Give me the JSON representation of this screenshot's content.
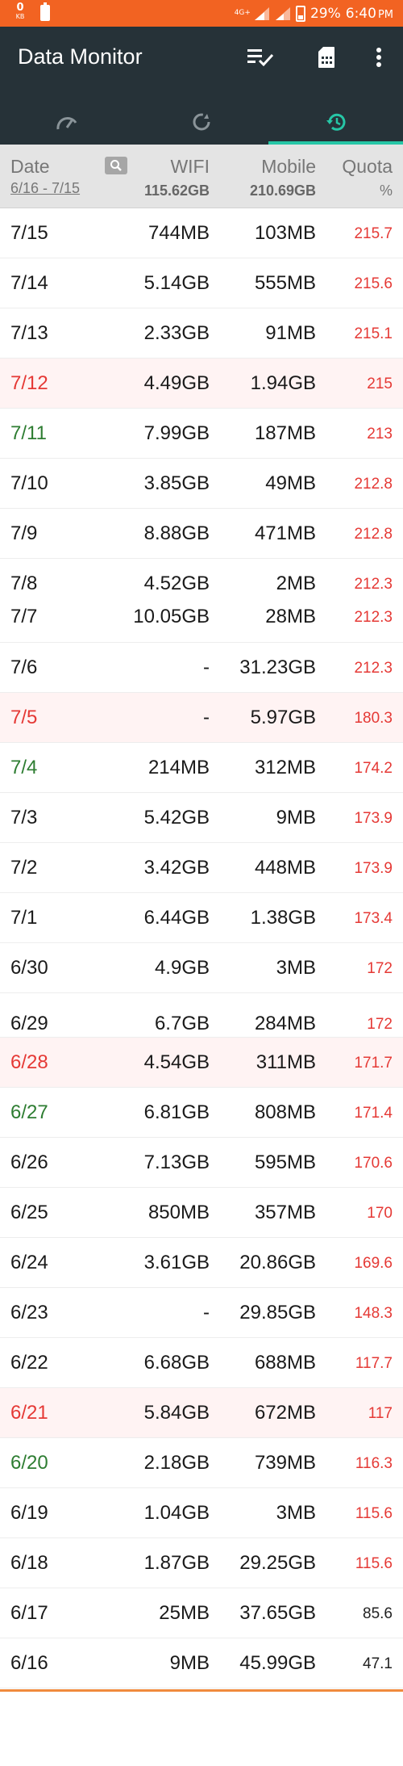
{
  "statusbar": {
    "speed_value": "0",
    "speed_unit": "KB",
    "network_type": "4G+",
    "battery_percent": "29%",
    "time": "6:40",
    "ampm": "PM"
  },
  "appbar": {
    "title": "Data Monitor"
  },
  "tabs": [
    {
      "icon": "gauge-icon",
      "active": false
    },
    {
      "icon": "cycle-icon",
      "active": false
    },
    {
      "icon": "history-icon",
      "active": true
    }
  ],
  "header": {
    "date_label": "Date",
    "date_range": "6/16 - 7/15",
    "wifi_label": "WIFI",
    "wifi_total": "115.62GB",
    "mobile_label": "Mobile",
    "mobile_total": "210.69GB",
    "quota_label": "Quota",
    "quota_unit": "%"
  },
  "colors": {
    "statusbar": "#f26322",
    "appbar": "#263238",
    "tab_indicator": "#26c6a6",
    "quota_red": "#e53935",
    "date_green": "#2e7d32"
  },
  "rows": [
    {
      "date": "7/15",
      "wifi": "744MB",
      "mobile": "103MB",
      "quota": "215.7",
      "date_color": "normal"
    },
    {
      "date": "7/14",
      "wifi": "5.14GB",
      "mobile": "555MB",
      "quota": "215.6",
      "date_color": "normal"
    },
    {
      "date": "7/13",
      "wifi": "2.33GB",
      "mobile": "91MB",
      "quota": "215.1",
      "date_color": "normal"
    },
    {
      "date": "7/12",
      "wifi": "4.49GB",
      "mobile": "1.94GB",
      "quota": "215",
      "date_color": "red"
    },
    {
      "date": "7/11",
      "wifi": "7.99GB",
      "mobile": "187MB",
      "quota": "213",
      "date_color": "green"
    },
    {
      "date": "7/10",
      "wifi": "3.85GB",
      "mobile": "49MB",
      "quota": "212.8",
      "date_color": "normal"
    },
    {
      "date": "7/9",
      "wifi": "8.88GB",
      "mobile": "471MB",
      "quota": "212.8",
      "date_color": "normal"
    },
    {
      "date": "7/8",
      "wifi": "4.52GB",
      "mobile": "2MB",
      "quota": "212.3",
      "date_color": "normal"
    },
    {
      "date": "7/7",
      "wifi": "10.05GB",
      "mobile": "28MB",
      "quota": "212.3",
      "date_color": "normal"
    },
    {
      "date": "7/6",
      "wifi": "-",
      "mobile": "31.23GB",
      "quota": "212.3",
      "date_color": "normal"
    },
    {
      "date": "7/5",
      "wifi": "-",
      "mobile": "5.97GB",
      "quota": "180.3",
      "date_color": "red"
    },
    {
      "date": "7/4",
      "wifi": "214MB",
      "mobile": "312MB",
      "quota": "174.2",
      "date_color": "green"
    },
    {
      "date": "7/3",
      "wifi": "5.42GB",
      "mobile": "9MB",
      "quota": "173.9",
      "date_color": "normal"
    },
    {
      "date": "7/2",
      "wifi": "3.42GB",
      "mobile": "448MB",
      "quota": "173.9",
      "date_color": "normal"
    },
    {
      "date": "7/1",
      "wifi": "6.44GB",
      "mobile": "1.38GB",
      "quota": "173.4",
      "date_color": "normal"
    },
    {
      "date": "6/30",
      "wifi": "4.9GB",
      "mobile": "3MB",
      "quota": "172",
      "date_color": "normal"
    },
    {
      "date": "6/29",
      "wifi": "6.7GB",
      "mobile": "284MB",
      "quota": "172",
      "date_color": "normal"
    },
    {
      "date": "6/28",
      "wifi": "4.54GB",
      "mobile": "311MB",
      "quota": "171.7",
      "date_color": "red"
    },
    {
      "date": "6/27",
      "wifi": "6.81GB",
      "mobile": "808MB",
      "quota": "171.4",
      "date_color": "green"
    },
    {
      "date": "6/26",
      "wifi": "7.13GB",
      "mobile": "595MB",
      "quota": "170.6",
      "date_color": "normal"
    },
    {
      "date": "6/25",
      "wifi": "850MB",
      "mobile": "357MB",
      "quota": "170",
      "date_color": "normal"
    },
    {
      "date": "6/24",
      "wifi": "3.61GB",
      "mobile": "20.86GB",
      "quota": "169.6",
      "date_color": "normal"
    },
    {
      "date": "6/23",
      "wifi": "-",
      "mobile": "29.85GB",
      "quota": "148.3",
      "date_color": "normal"
    },
    {
      "date": "6/22",
      "wifi": "6.68GB",
      "mobile": "688MB",
      "quota": "117.7",
      "date_color": "normal"
    },
    {
      "date": "6/21",
      "wifi": "5.84GB",
      "mobile": "672MB",
      "quota": "117",
      "date_color": "red"
    },
    {
      "date": "6/20",
      "wifi": "2.18GB",
      "mobile": "739MB",
      "quota": "116.3",
      "date_color": "green"
    },
    {
      "date": "6/19",
      "wifi": "1.04GB",
      "mobile": "3MB",
      "quota": "115.6",
      "date_color": "normal"
    },
    {
      "date": "6/18",
      "wifi": "1.87GB",
      "mobile": "29.25GB",
      "quota": "115.6",
      "date_color": "normal"
    },
    {
      "date": "6/17",
      "wifi": "25MB",
      "mobile": "37.65GB",
      "quota": "85.6",
      "date_color": "normal"
    },
    {
      "date": "6/16",
      "wifi": "9MB",
      "mobile": "45.99GB",
      "quota": "47.1",
      "date_color": "normal"
    }
  ]
}
